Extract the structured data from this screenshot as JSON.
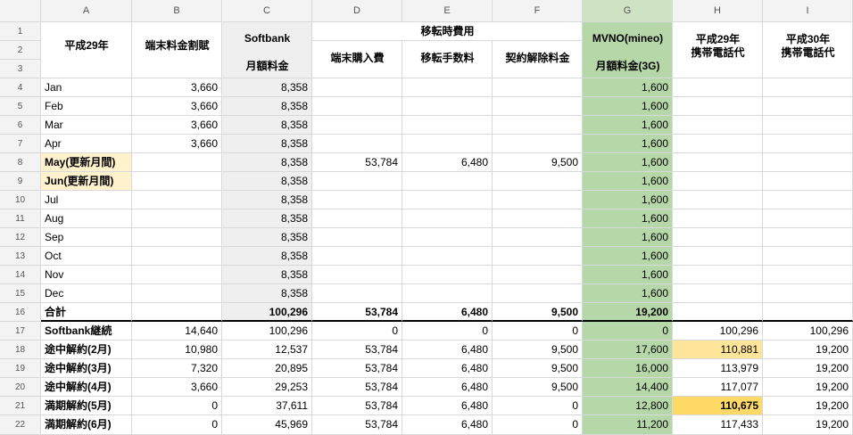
{
  "column_headers": [
    "A",
    "B",
    "C",
    "D",
    "E",
    "F",
    "G",
    "H",
    "I"
  ],
  "row_numbers": [
    "1",
    "2",
    "3",
    "4",
    "5",
    "6",
    "7",
    "8",
    "9",
    "10",
    "11",
    "12",
    "13",
    "14",
    "15",
    "16",
    "17",
    "18",
    "19",
    "20",
    "21",
    "22"
  ],
  "headers": {
    "a": "平成29年",
    "b": "端末料金割賦",
    "c_top": "Softbank",
    "c_bottom": "月額料金",
    "def_group": "移転時費用",
    "d": "端末購入費",
    "e": "移転手数料",
    "f": "契約解除料金",
    "g_top": "MVNO(mineo)",
    "g_bottom": "月額料金(3G)",
    "h_line1": "平成29年",
    "h_line2": "携帯電話代",
    "i_line1": "平成30年",
    "i_line2": "携帯電話代"
  },
  "rows": [
    {
      "a": "Jan",
      "b": "3,660",
      "c": "8,358",
      "d": "",
      "e": "",
      "f": "",
      "g": "1,600",
      "h": "",
      "i": ""
    },
    {
      "a": "Feb",
      "b": "3,660",
      "c": "8,358",
      "d": "",
      "e": "",
      "f": "",
      "g": "1,600",
      "h": "",
      "i": ""
    },
    {
      "a": "Mar",
      "b": "3,660",
      "c": "8,358",
      "d": "",
      "e": "",
      "f": "",
      "g": "1,600",
      "h": "",
      "i": ""
    },
    {
      "a": "Apr",
      "b": "3,660",
      "c": "8,358",
      "d": "",
      "e": "",
      "f": "",
      "g": "1,600",
      "h": "",
      "i": ""
    },
    {
      "a": "May(更新月間)",
      "b": "",
      "c": "8,358",
      "d": "53,784",
      "e": "6,480",
      "f": "9,500",
      "g": "1,600",
      "h": "",
      "i": ""
    },
    {
      "a": "Jun(更新月間)",
      "b": "",
      "c": "8,358",
      "d": "",
      "e": "",
      "f": "",
      "g": "1,600",
      "h": "",
      "i": ""
    },
    {
      "a": "Jul",
      "b": "",
      "c": "8,358",
      "d": "",
      "e": "",
      "f": "",
      "g": "1,600",
      "h": "",
      "i": ""
    },
    {
      "a": "Aug",
      "b": "",
      "c": "8,358",
      "d": "",
      "e": "",
      "f": "",
      "g": "1,600",
      "h": "",
      "i": ""
    },
    {
      "a": "Sep",
      "b": "",
      "c": "8,358",
      "d": "",
      "e": "",
      "f": "",
      "g": "1,600",
      "h": "",
      "i": ""
    },
    {
      "a": "Oct",
      "b": "",
      "c": "8,358",
      "d": "",
      "e": "",
      "f": "",
      "g": "1,600",
      "h": "",
      "i": ""
    },
    {
      "a": "Nov",
      "b": "",
      "c": "8,358",
      "d": "",
      "e": "",
      "f": "",
      "g": "1,600",
      "h": "",
      "i": ""
    },
    {
      "a": "Dec",
      "b": "",
      "c": "8,358",
      "d": "",
      "e": "",
      "f": "",
      "g": "1,600",
      "h": "",
      "i": ""
    },
    {
      "a": "合計",
      "b": "",
      "c": "100,296",
      "d": "53,784",
      "e": "6,480",
      "f": "9,500",
      "g": "19,200",
      "h": "",
      "i": ""
    },
    {
      "a": "Softbank継続",
      "b": "14,640",
      "c": "100,296",
      "d": "0",
      "e": "0",
      "f": "0",
      "g": "0",
      "h": "100,296",
      "i": "100,296"
    },
    {
      "a": "途中解約(2月)",
      "b": "10,980",
      "c": "12,537",
      "d": "53,784",
      "e": "6,480",
      "f": "9,500",
      "g": "17,600",
      "h": "110,881",
      "i": "19,200"
    },
    {
      "a": "途中解約(3月)",
      "b": "7,320",
      "c": "20,895",
      "d": "53,784",
      "e": "6,480",
      "f": "9,500",
      "g": "16,000",
      "h": "113,979",
      "i": "19,200"
    },
    {
      "a": "途中解約(4月)",
      "b": "3,660",
      "c": "29,253",
      "d": "53,784",
      "e": "6,480",
      "f": "9,500",
      "g": "14,400",
      "h": "117,077",
      "i": "19,200"
    },
    {
      "a": "満期解約(5月)",
      "b": "0",
      "c": "37,611",
      "d": "53,784",
      "e": "6,480",
      "f": "0",
      "g": "12,800",
      "h": "110,675",
      "i": "19,200"
    },
    {
      "a": "満期解約(6月)",
      "b": "0",
      "c": "45,969",
      "d": "53,784",
      "e": "6,480",
      "f": "0",
      "g": "11,200",
      "h": "117,433",
      "i": "19,200"
    }
  ],
  "colors": {
    "green_column": "#b6d7a8",
    "gray_column": "#efefef",
    "highlight_light": "#fff2cc",
    "highlight_mid": "#ffe599",
    "highlight_strong": "#ffd966",
    "header_bg": "#f3f3f3",
    "gridline": "#d9d9d9"
  }
}
